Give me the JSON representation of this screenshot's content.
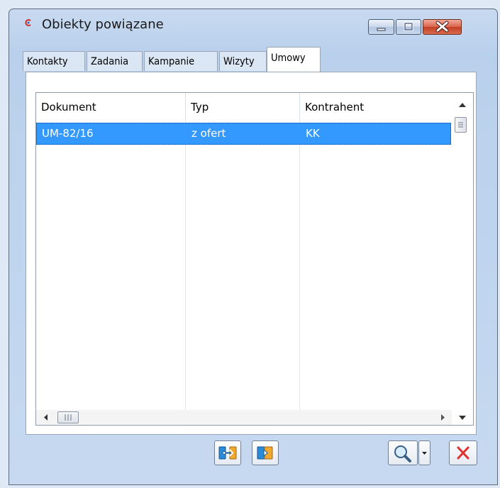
{
  "window": {
    "title": "Obiekty powiązane"
  },
  "tabs": [
    {
      "label": "Kontakty"
    },
    {
      "label": "Zadania"
    },
    {
      "label": "Kampanie"
    },
    {
      "label": "Wizyty"
    },
    {
      "label": "Umowy",
      "active": true
    }
  ],
  "table": {
    "columns": [
      "Dokument",
      "Typ",
      "Kontrahent"
    ],
    "rows": [
      {
        "dokument": "UM-82/16",
        "typ": "z ofert",
        "kontrahent": "KK",
        "selected": true
      }
    ]
  },
  "colors": {
    "selection": "#3399ff",
    "close_icon": "#e03030",
    "tool_icon": "#2a8ad6"
  },
  "icons": [
    "minimize-icon",
    "maximize-icon",
    "close-icon",
    "link-icon",
    "unlink-icon",
    "search-icon",
    "chevron-down-icon",
    "delete-icon"
  ]
}
